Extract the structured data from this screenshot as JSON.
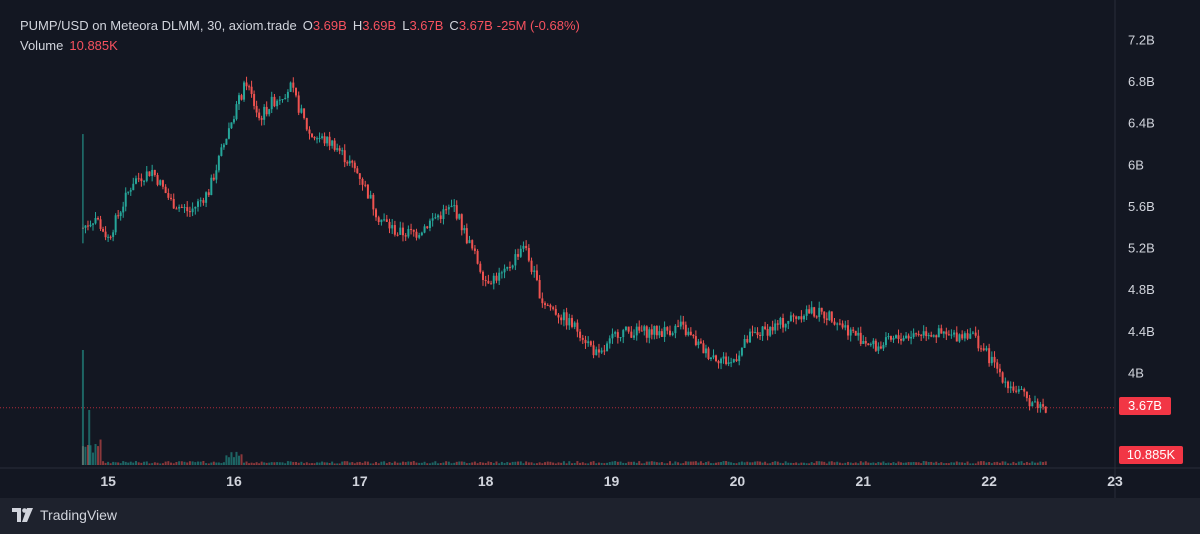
{
  "legend": {
    "symbol": "PUMP/USD on Meteora DLMM, 30, axiom.trade",
    "o_label": "O",
    "o_value": "3.69B",
    "h_label": "H",
    "h_value": "3.69B",
    "l_label": "L",
    "l_value": "3.67B",
    "c_label": "C",
    "c_value": "3.67B",
    "change": "-25M (-0.68%)",
    "volume_label": "Volume",
    "volume_value": "10.885K"
  },
  "price_axis": {
    "ticks": [
      "7.2B",
      "6.8B",
      "6.4B",
      "6B",
      "5.6B",
      "5.2B",
      "4.8B",
      "4.4B",
      "4B"
    ],
    "current_price": "3.67B",
    "current_volume": "10.885K"
  },
  "time_axis": {
    "ticks": [
      "15",
      "16",
      "17",
      "18",
      "19",
      "20",
      "21",
      "22",
      "23"
    ]
  },
  "brand": {
    "name": "TradingView"
  },
  "colors": {
    "up": "#26a69a",
    "down": "#ef5350",
    "background": "#131722",
    "badge": "#f23645"
  },
  "chart_data": {
    "type": "line",
    "title": "PUMP/USD on Meteora DLMM, 30, axiom.trade",
    "xlabel": "",
    "ylabel": "",
    "x": [
      14.8,
      14.9,
      15.0,
      15.2,
      15.35,
      15.5,
      15.65,
      15.8,
      16.0,
      16.1,
      16.2,
      16.3,
      16.45,
      16.6,
      16.8,
      17.0,
      17.15,
      17.3,
      17.45,
      17.6,
      17.75,
      17.85,
      18.0,
      18.15,
      18.3,
      18.45,
      18.6,
      18.75,
      18.9,
      19.05,
      19.2,
      19.4,
      19.55,
      19.75,
      19.95,
      20.1,
      20.3,
      20.55,
      20.75,
      20.9,
      21.1,
      21.3,
      21.5,
      21.7,
      21.85,
      22.0,
      22.15,
      22.3,
      22.45
    ],
    "y": [
      5.4,
      5.5,
      5.3,
      5.85,
      5.95,
      5.65,
      5.55,
      5.75,
      6.5,
      6.8,
      6.45,
      6.6,
      6.75,
      6.3,
      6.2,
      5.9,
      5.5,
      5.35,
      5.35,
      5.5,
      5.6,
      5.3,
      4.9,
      4.95,
      5.25,
      4.7,
      4.55,
      4.4,
      4.15,
      4.4,
      4.4,
      4.4,
      4.45,
      4.2,
      4.1,
      4.35,
      4.45,
      4.6,
      4.55,
      4.4,
      4.25,
      4.35,
      4.4,
      4.35,
      4.4,
      4.15,
      3.9,
      3.75,
      3.67
    ],
    "y_unit": "B",
    "ylim": [
      3.6,
      7.3
    ],
    "xlim": [
      14.3,
      23.0
    ],
    "volume": {
      "x": [
        14.8,
        14.85,
        14.95,
        15.9,
        16.0,
        16.1,
        17.0,
        17.8,
        19.0,
        20.0,
        21.0,
        22.0,
        22.45
      ],
      "values": [
        60,
        28,
        18,
        10,
        14,
        8,
        4,
        4,
        4,
        3,
        3,
        3,
        3
      ],
      "unit": "K"
    },
    "grid": false,
    "legend_position": "top-left"
  }
}
